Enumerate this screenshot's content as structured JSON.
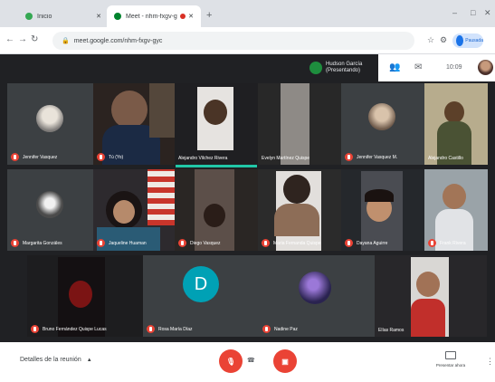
{
  "browser": {
    "tabs": [
      {
        "title": "Inicio",
        "active": false
      },
      {
        "title": "Meet - nhm-fxgv-gyc",
        "active": true
      }
    ],
    "new_tab_label": "+",
    "address": "meet.google.com/nhm-fxgv-gyc",
    "profile_label": "Pausada"
  },
  "meet_top": {
    "presenter_line1": "Hudson García",
    "presenter_line2": "(Presentando)",
    "time": "10:09"
  },
  "participants": [
    {
      "name": "Jennifer Vasquez",
      "tile": "avatar-photo"
    },
    {
      "name": "Tú (Yo)",
      "tile": "video"
    },
    {
      "name": "Alejandro Vilchez Rivera",
      "tile": "video"
    },
    {
      "name": "Evelyn Martínez Quispe",
      "tile": "dark"
    },
    {
      "name": "Jennifer Vasquez M.",
      "tile": "avatar-photo"
    },
    {
      "name": "Alejandro Castillo",
      "tile": "video"
    },
    {
      "name": "Margarita Gonzáles",
      "tile": "avatar-photo"
    },
    {
      "name": "Jaqueline Huaman",
      "tile": "video"
    },
    {
      "name": "Diego Vasquez",
      "tile": "video"
    },
    {
      "name": "Maria Fernanda Quispe",
      "tile": "video"
    },
    {
      "name": "Dayana Aguirre",
      "tile": "video"
    },
    {
      "name": "Frank Rivera",
      "tile": "video"
    },
    {
      "name": "Bruno Fernández Quispe Lucas",
      "tile": "video"
    },
    {
      "name": "Rosa María Díaz",
      "tile": "avatar-letter",
      "initial": "D"
    },
    {
      "name": "Nadine Paz",
      "tile": "avatar-photo"
    },
    {
      "name": "Elías Ramos",
      "tile": "video"
    }
  ],
  "bottom": {
    "meeting_details": "Detalles de la reunión",
    "mic_icon": "mic-off-icon",
    "cam_icon": "camera-off-icon",
    "hangup": "hangup-icon",
    "present_label": "Presentar ahora"
  },
  "colors": {
    "meet_bg": "#202124",
    "tile_bg": "#3c4043",
    "danger": "#ea4335",
    "speaking": "#21c7a8",
    "accent": "#1a73e8",
    "letter_avatar": "#00a1b5"
  }
}
